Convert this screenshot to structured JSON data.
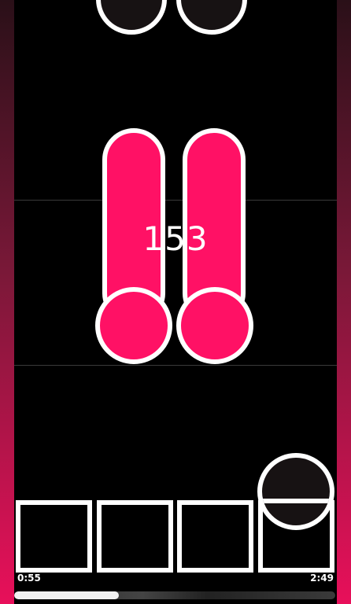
{
  "hud": {
    "combo": "153",
    "elapsed": "0:55",
    "total": "2:49",
    "progress": 0.325
  },
  "colors": {
    "note_pink": "#ff1165",
    "note_dark": "#171213",
    "outline": "#ffffff",
    "side_glow": "#e8105a"
  }
}
